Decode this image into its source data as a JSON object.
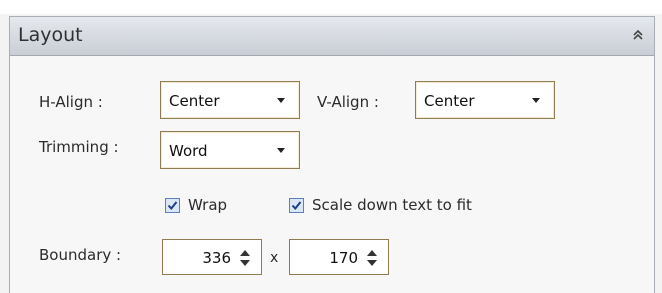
{
  "panel": {
    "title": "Layout",
    "collapse_icon": "double-chevron-up-icon"
  },
  "h_align": {
    "label": "H-Align :",
    "value": "Center"
  },
  "v_align": {
    "label": "V-Align :",
    "value": "Center"
  },
  "trimming": {
    "label": "Trimming :",
    "value": "Word"
  },
  "wrap": {
    "label": "Wrap",
    "checked": true
  },
  "scale_down": {
    "label": "Scale down text to fit",
    "checked": true
  },
  "boundary": {
    "label": "Boundary :",
    "width": "336",
    "separator": "x",
    "height": "170"
  },
  "colors": {
    "header_top": "#e5e8ec",
    "header_bottom": "#c9ced6",
    "field_border": "#8f7d51",
    "checkbox_fill": "#dbe7f8",
    "check_mark": "#1f3f84"
  }
}
